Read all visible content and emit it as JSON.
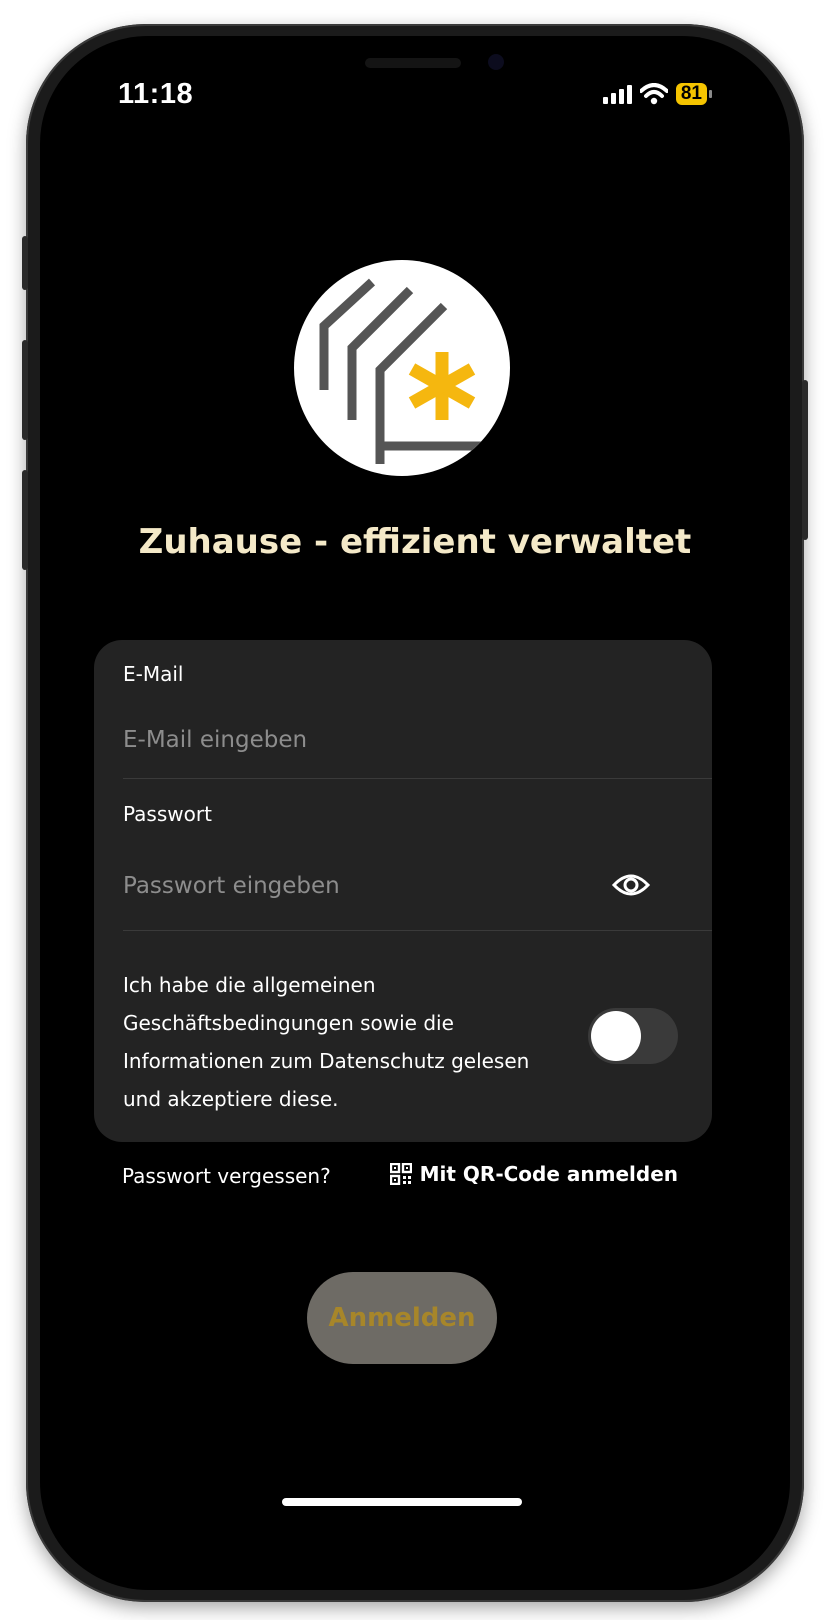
{
  "status_bar": {
    "time": "11:18",
    "battery_level": "81",
    "battery_color": "#f5c400",
    "icons": [
      "signal-icon",
      "wifi-icon",
      "battery-icon"
    ]
  },
  "branding": {
    "tagline": "Zuhause - effizient verwaltet",
    "tagline_color": "#f4e9c8",
    "accent_color": "#f5b70f"
  },
  "login_form": {
    "email": {
      "label": "E-Mail",
      "placeholder": "E-Mail eingeben",
      "value": ""
    },
    "password": {
      "label": "Passwort",
      "placeholder": "Passwort eingeben",
      "value": "",
      "visibility_icon": "eye-icon"
    },
    "terms": {
      "text": "Ich habe die allgemeinen Geschäftsbedingungen sowie die Informationen zum Datenschutz gelesen und akzeptiere diese.",
      "accepted": false
    }
  },
  "links": {
    "forgot_password": "Passwort vergessen?",
    "qr_login": "Mit QR-Code anmelden",
    "qr_icon": "qr-code-icon"
  },
  "login_button": {
    "label": "Anmelden",
    "enabled": false
  }
}
